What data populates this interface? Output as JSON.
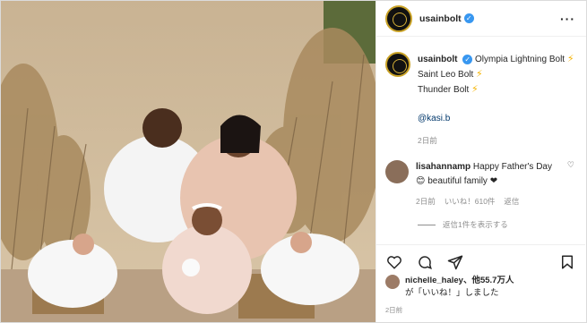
{
  "post": {
    "username": "usainbolt",
    "photo_alt": "",
    "caption": {
      "username": "usainbolt",
      "line1": "Olympia Lightning Bolt",
      "line2": "Saint Leo Bolt",
      "line3": "Thunder Bolt",
      "mention": "@kasi.b",
      "time": "2日前"
    },
    "comment": {
      "username": "lisahannamp",
      "text": "Happy Father's Day",
      "text2": "beautiful family",
      "time": "2日前",
      "likes": "いいね！610件",
      "reply": "返信",
      "view_replies": "返信1件を表示する"
    },
    "likes": {
      "username": "nichelle_haley",
      "suffix": "、他55.7万人",
      "suffix2": "が「いいね！」しました"
    },
    "time": "2日前"
  },
  "colors": {
    "verified": "#3897f0",
    "bolt": "#f5b301",
    "border": "#dbdbdb",
    "muted": "#8e8e8e"
  },
  "icons": [
    "verified-icon",
    "more-icon",
    "lightning-bolt-icon",
    "heart-icon",
    "comment-icon",
    "share-icon",
    "save-icon"
  ]
}
